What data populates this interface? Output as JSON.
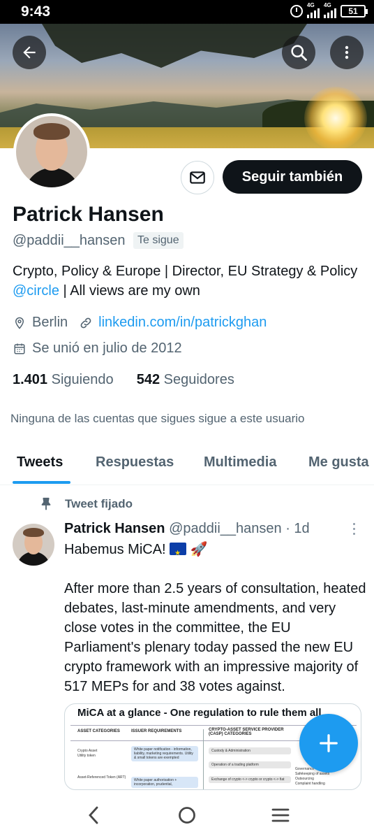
{
  "status_bar": {
    "time": "9:43",
    "network1": "4G",
    "network2": "4G",
    "battery": "51"
  },
  "profile": {
    "name": "Patrick Hansen",
    "handle": "@paddii__hansen",
    "follows_you": "Te sigue",
    "bio_before": "Crypto, Policy & Europe | Director, EU Strategy & Policy ",
    "bio_mention": "@circle",
    "bio_after": " | All views are my own",
    "location": "Berlin",
    "website": "linkedin.com/in/patrickghan",
    "joined": "Se unió en julio de 2012",
    "following_count": "1.401",
    "following_label": "Siguiendo",
    "followers_count": "542",
    "followers_label": "Seguidores",
    "no_mutuals": "Ninguna de las cuentas que sigues sigue a este usuario"
  },
  "actions": {
    "follow_label": "Seguir también"
  },
  "tabs": [
    "Tweets",
    "Respuestas",
    "Multimedia",
    "Me gusta"
  ],
  "tweet": {
    "pinned_label": "Tweet fijado",
    "author_name": "Patrick Hansen",
    "author_handle": "@paddii__hansen",
    "time": "· 1d",
    "line1": "Habemus MiCA! ",
    "rocket": "🚀",
    "body": "After more than 2.5 years of consultation, heated debates, last-minute amendments, and very close votes in the committee, the EU Parliament's plenary today passed the new EU crypto framework with an impressive majority of 517 MEPs for and 38 votes against."
  },
  "image_card": {
    "title": "MiCA at a glance - One regulation to rule them all",
    "col1_header": "ASSET CATEGORIES",
    "col2_header": "ISSUER REQUIREMENTS",
    "col3_header": "CRYPTO-ASSET SERVICE PROVIDER (CASP) CATEGORIES",
    "row1_asset": "Crypto Asset",
    "row1_asset_sub": "Utility token",
    "row1_req": "White paper notification - information, liability, marketing requirements. Utility & small tokens are exempted",
    "casp1": "Custody & Administration",
    "casp2": "Operation of a trading platform",
    "casp3": "Exchange of crypto <-> crypto or crypto <-> fiat",
    "row2_asset": "Asset-Referenced Token (ART)",
    "row2_req": "White paper authorisation + incorporation, prudential,",
    "right1": "Governance",
    "right2": "Safekeeping of assets",
    "right3": "Outsourcing",
    "right4": "Complaint handling"
  },
  "colors": {
    "accent": "#1d9bf0",
    "text": "#0f1419",
    "secondary": "#536471",
    "follow_bg": "#0f1419"
  }
}
